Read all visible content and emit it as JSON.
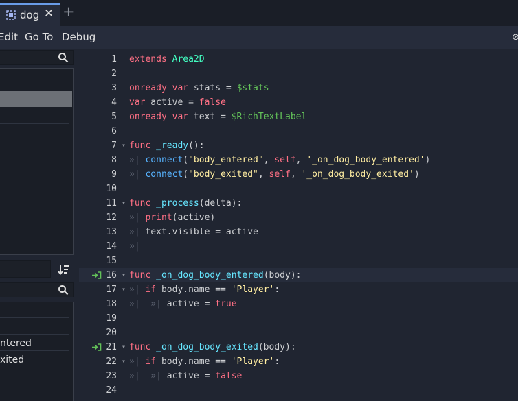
{
  "tabs": [
    {
      "label": "dog",
      "icon": "area2d-icon"
    }
  ],
  "menu": [
    "Edit",
    "Go To",
    "Debug"
  ],
  "methods_panel": {
    "items": [
      "ntered",
      "xited"
    ]
  },
  "code": [
    {
      "n": "1",
      "fold": "",
      "conn": false,
      "seg": [
        {
          "t": "extends",
          "c": "k"
        },
        {
          "t": " ",
          "c": "p"
        },
        {
          "t": "Area2D",
          "c": "t"
        }
      ]
    },
    {
      "n": "2",
      "fold": "",
      "conn": false,
      "seg": []
    },
    {
      "n": "3",
      "fold": "",
      "conn": false,
      "seg": [
        {
          "t": "onready",
          "c": "k"
        },
        {
          "t": " ",
          "c": "p"
        },
        {
          "t": "var",
          "c": "k"
        },
        {
          "t": " stats = ",
          "c": "p"
        },
        {
          "t": "$stats",
          "c": "n"
        }
      ]
    },
    {
      "n": "4",
      "fold": "",
      "conn": false,
      "seg": [
        {
          "t": "var",
          "c": "k"
        },
        {
          "t": " active = ",
          "c": "p"
        },
        {
          "t": "false",
          "c": "k"
        }
      ]
    },
    {
      "n": "5",
      "fold": "",
      "conn": false,
      "seg": [
        {
          "t": "onready",
          "c": "k"
        },
        {
          "t": " ",
          "c": "p"
        },
        {
          "t": "var",
          "c": "k"
        },
        {
          "t": " text = ",
          "c": "p"
        },
        {
          "t": "$RichTextLabel",
          "c": "n"
        }
      ]
    },
    {
      "n": "6",
      "fold": "",
      "conn": false,
      "seg": []
    },
    {
      "n": "7",
      "fold": "v",
      "conn": false,
      "seg": [
        {
          "t": "func",
          "c": "k"
        },
        {
          "t": " ",
          "c": "p"
        },
        {
          "t": "_ready",
          "c": "d"
        },
        {
          "t": "():",
          "c": "p"
        }
      ]
    },
    {
      "n": "8",
      "fold": "",
      "conn": false,
      "seg": [
        {
          "t": "»| ",
          "c": "tabmark"
        },
        {
          "t": "connect",
          "c": "f"
        },
        {
          "t": "(",
          "c": "p"
        },
        {
          "t": "\"body_entered\"",
          "c": "s"
        },
        {
          "t": ", ",
          "c": "p"
        },
        {
          "t": "self",
          "c": "k"
        },
        {
          "t": ", ",
          "c": "p"
        },
        {
          "t": "'_on_dog_body_entered'",
          "c": "s"
        },
        {
          "t": ")",
          "c": "p"
        }
      ]
    },
    {
      "n": "9",
      "fold": "",
      "conn": false,
      "seg": [
        {
          "t": "»| ",
          "c": "tabmark"
        },
        {
          "t": "connect",
          "c": "f"
        },
        {
          "t": "(",
          "c": "p"
        },
        {
          "t": "\"body_exited\"",
          "c": "s"
        },
        {
          "t": ", ",
          "c": "p"
        },
        {
          "t": "self",
          "c": "k"
        },
        {
          "t": ", ",
          "c": "p"
        },
        {
          "t": "'_on_dog_body_exited'",
          "c": "s"
        },
        {
          "t": ")",
          "c": "p"
        }
      ]
    },
    {
      "n": "10",
      "fold": "",
      "conn": false,
      "seg": []
    },
    {
      "n": "11",
      "fold": "v",
      "conn": false,
      "seg": [
        {
          "t": "func",
          "c": "k"
        },
        {
          "t": " ",
          "c": "p"
        },
        {
          "t": "_process",
          "c": "d"
        },
        {
          "t": "(delta):",
          "c": "p"
        }
      ]
    },
    {
      "n": "12",
      "fold": "",
      "conn": false,
      "seg": [
        {
          "t": "»| ",
          "c": "tabmark"
        },
        {
          "t": "print",
          "c": "k"
        },
        {
          "t": "(active)",
          "c": "p"
        }
      ]
    },
    {
      "n": "13",
      "fold": "",
      "conn": false,
      "seg": [
        {
          "t": "»| ",
          "c": "tabmark"
        },
        {
          "t": "text.visible = active",
          "c": "p"
        }
      ]
    },
    {
      "n": "14",
      "fold": "",
      "conn": false,
      "seg": [
        {
          "t": "»|",
          "c": "tabmark"
        }
      ]
    },
    {
      "n": "15",
      "fold": "",
      "conn": false,
      "seg": []
    },
    {
      "n": "16",
      "fold": "v",
      "conn": true,
      "current": true,
      "seg": [
        {
          "t": "func",
          "c": "k"
        },
        {
          "t": " ",
          "c": "p"
        },
        {
          "t": "_on_dog_body_entered",
          "c": "d"
        },
        {
          "t": "(body):",
          "c": "p"
        }
      ]
    },
    {
      "n": "17",
      "fold": "v",
      "conn": false,
      "seg": [
        {
          "t": "»| ",
          "c": "tabmark"
        },
        {
          "t": "if",
          "c": "k"
        },
        {
          "t": " body.name == ",
          "c": "p"
        },
        {
          "t": "'Player'",
          "c": "s"
        },
        {
          "t": ":",
          "c": "p"
        }
      ]
    },
    {
      "n": "18",
      "fold": "",
      "conn": false,
      "seg": [
        {
          "t": "»|  »| ",
          "c": "tabmark"
        },
        {
          "t": "active = ",
          "c": "p"
        },
        {
          "t": "true",
          "c": "k"
        }
      ]
    },
    {
      "n": "19",
      "fold": "",
      "conn": false,
      "seg": []
    },
    {
      "n": "20",
      "fold": "",
      "conn": false,
      "seg": []
    },
    {
      "n": "21",
      "fold": "v",
      "conn": true,
      "seg": [
        {
          "t": "func",
          "c": "k"
        },
        {
          "t": " ",
          "c": "p"
        },
        {
          "t": "_on_dog_body_exited",
          "c": "d"
        },
        {
          "t": "(body):",
          "c": "p"
        }
      ]
    },
    {
      "n": "22",
      "fold": "v",
      "conn": false,
      "seg": [
        {
          "t": "»| ",
          "c": "tabmark"
        },
        {
          "t": "if",
          "c": "k"
        },
        {
          "t": " body.name == ",
          "c": "p"
        },
        {
          "t": "'Player'",
          "c": "s"
        },
        {
          "t": ":",
          "c": "p"
        }
      ]
    },
    {
      "n": "23",
      "fold": "",
      "conn": false,
      "seg": [
        {
          "t": "»|  »| ",
          "c": "tabmark"
        },
        {
          "t": "active = ",
          "c": "p"
        },
        {
          "t": "false",
          "c": "k"
        }
      ]
    },
    {
      "n": "24",
      "fold": "",
      "conn": false,
      "seg": []
    }
  ]
}
